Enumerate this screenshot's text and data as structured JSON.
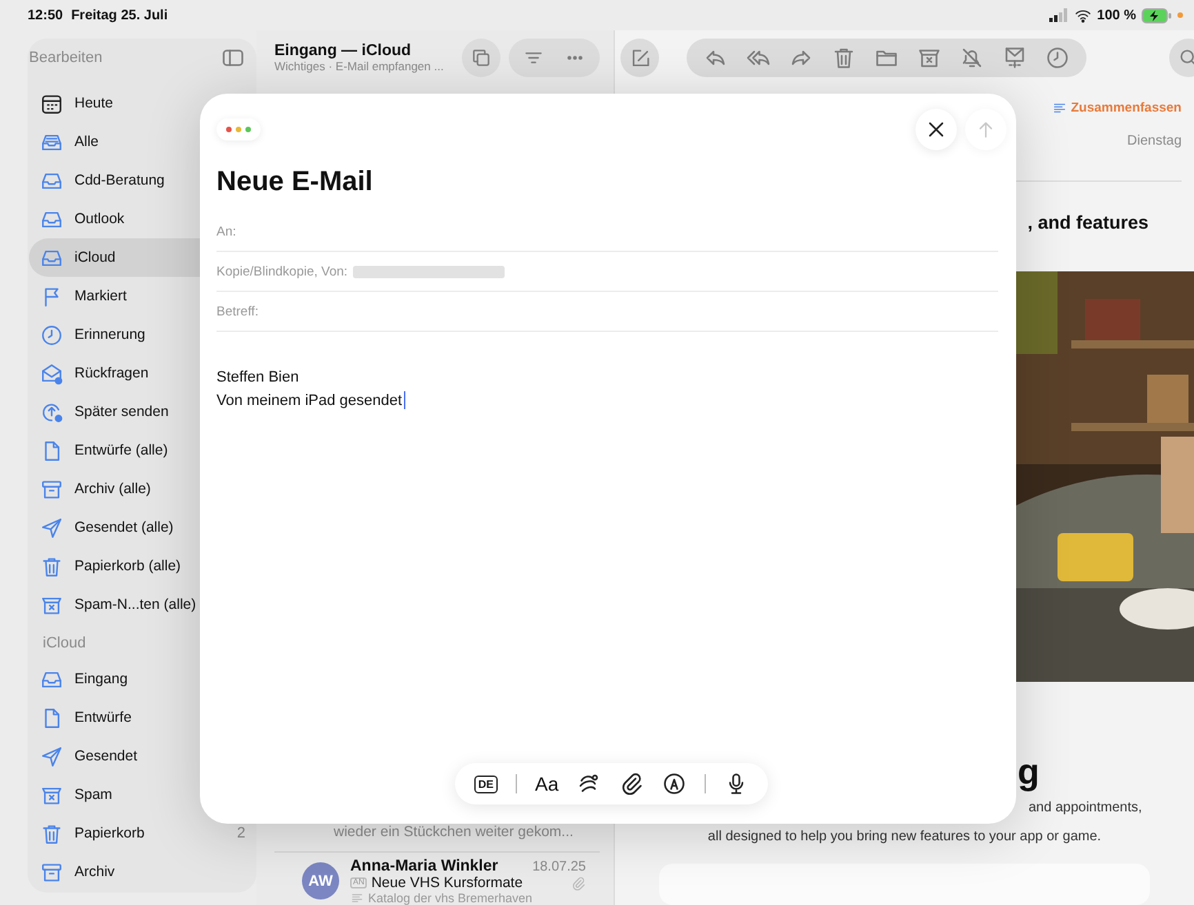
{
  "status_bar": {
    "time": "12:50",
    "date": "Freitag 25. Juli",
    "battery": "100 %"
  },
  "sidebar": {
    "edit_label": "Bearbeiten",
    "groups": [
      {
        "items": [
          {
            "label": "Heute",
            "selected": false
          },
          {
            "label": "Alle",
            "selected": false
          },
          {
            "label": "Cdd-Beratung",
            "selected": false
          },
          {
            "label": "Outlook",
            "selected": false
          },
          {
            "label": "iCloud",
            "selected": true
          },
          {
            "label": "Markiert",
            "selected": false
          },
          {
            "label": "Erinnerung",
            "selected": false
          },
          {
            "label": "Rückfragen",
            "selected": false
          },
          {
            "label": "Später senden",
            "selected": false
          },
          {
            "label": "Entwürfe (alle)",
            "selected": false
          },
          {
            "label": "Archiv (alle)",
            "selected": false
          },
          {
            "label": "Gesendet (alle)",
            "selected": false
          },
          {
            "label": "Papierkorb (alle)",
            "selected": false
          },
          {
            "label": "Spam-N...ten (alle)",
            "selected": false
          }
        ]
      },
      {
        "title": "iCloud",
        "items": [
          {
            "label": "Eingang",
            "selected": false
          },
          {
            "label": "Entwürfe",
            "selected": false
          },
          {
            "label": "Gesendet",
            "selected": false
          },
          {
            "label": "Spam",
            "selected": false
          },
          {
            "label": "Papierkorb",
            "selected": false,
            "count": "2"
          },
          {
            "label": "Archiv",
            "selected": false
          }
        ]
      }
    ]
  },
  "mailbox": {
    "title": "Eingang — iCloud",
    "subtitle": "Wichtiges · E-Mail empfangen ...",
    "preview_tail": "wieder ein Stückchen weiter gekom...",
    "messages": [
      {
        "initials": "AW",
        "sender": "Anna-Maria Winkler",
        "date": "18.07.25",
        "recipient_badge": "AN",
        "subject": "Neue VHS Kursformate",
        "summary": "Katalog der vhs Bremerhaven",
        "attachment": true
      }
    ]
  },
  "message": {
    "summarize": "Zusammenfassen",
    "day": "Dienstag",
    "heading_fragment": ", and features",
    "footer_heading_fragment": "g",
    "body_fragment": "and appointments,",
    "body_line": "all designed to help you bring new features to your app or game."
  },
  "compose": {
    "title": "Neue E-Mail",
    "send_disabled": true,
    "fields": [
      {
        "label": "An:",
        "redacted": false
      },
      {
        "label": "Kopie/Blindkopie, Von:",
        "redacted": true
      },
      {
        "label": "Betreff:",
        "redacted": false
      }
    ],
    "body": [
      "Steffen Bien",
      "Von meinem iPad gesendet"
    ],
    "keyboard_language": "DE",
    "format_label": "Aa"
  }
}
